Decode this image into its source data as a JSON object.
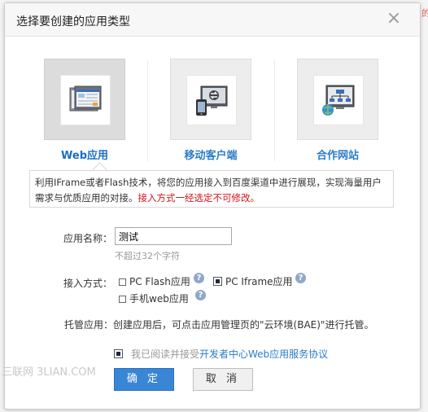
{
  "dialog": {
    "title": "选择要创建的应用类型",
    "close_symbol": "×",
    "types": [
      {
        "label": "Web应用",
        "icon": "web-app-icon",
        "selected": true
      },
      {
        "label": "移动客户端",
        "icon": "mobile-client-icon",
        "selected": false
      },
      {
        "label": "合作网站",
        "icon": "partner-site-icon",
        "selected": false
      }
    ],
    "info": {
      "text": "利用IFrame或者Flash技术，将您的应用接入到百度渠道中进行展现，实现海量用户需求与优质应用的对接。",
      "warning": "接入方式一经选定不可修改。"
    },
    "form": {
      "name_label": "应用名称：",
      "name_value": "测试",
      "name_hint": "不超过32个字符",
      "access_label": "接入方式：",
      "access_options": [
        {
          "label": "PC Flash应用",
          "checked": false
        },
        {
          "label": "PC Iframe应用",
          "checked": true
        },
        {
          "label": "手机web应用",
          "checked": false
        }
      ],
      "help_symbol": "?",
      "host_label": "托管应用：",
      "host_text": "创建应用后，可点击应用管理页的\"云环境(BAE)\"进行托管。"
    },
    "agreement": {
      "checked": true,
      "text": "我已阅读并接受",
      "link": "开发者中心Web应用服务协议"
    },
    "buttons": {
      "ok": "确 定",
      "cancel": "取 消"
    }
  },
  "watermark": "三联网 3LIAN.COM",
  "colors": {
    "accent": "#2a7cc7",
    "warning": "#d4141a",
    "ok_button": "#3a86d6"
  }
}
